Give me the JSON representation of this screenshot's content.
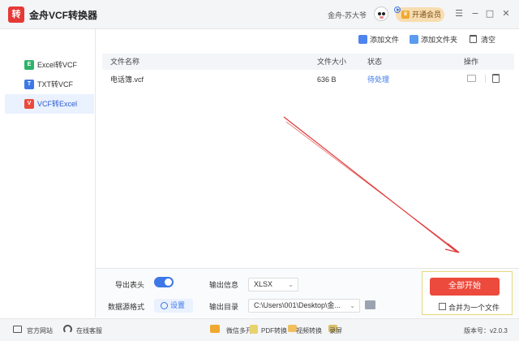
{
  "app": {
    "title": "金舟VCF转换器",
    "logo_glyph": "转",
    "user_name": "金舟-苏大爷",
    "vip_label": "开通会员",
    "vip_glyph": "♛",
    "window_controls": {
      "menu": "☰",
      "minimize": "−",
      "maximize": "□",
      "close": "✕"
    }
  },
  "sidebar": {
    "items": [
      {
        "label": "Excel转VCF",
        "badge": "E",
        "badge_color": "#2fb36b",
        "active": false
      },
      {
        "label": "TXT转VCF",
        "badge": "T",
        "badge_color": "#3d78e6",
        "active": false
      },
      {
        "label": "VCF转Excel",
        "badge": "V",
        "badge_color": "#ec4a3c",
        "active": true
      }
    ]
  },
  "toolbar": {
    "add_file": "添加文件",
    "add_folder": "添加文件夹",
    "clear": "清空"
  },
  "table": {
    "headers": {
      "name": "文件名称",
      "size": "文件大小",
      "status": "状态",
      "action": "操作"
    },
    "rows": [
      {
        "name": "电话簿.vcf",
        "size": "636 B",
        "status": "待处理"
      }
    ]
  },
  "options": {
    "export_header_label": "导出表头",
    "export_header_on": true,
    "source_format_label": "数据源格式",
    "settings_label": "设置",
    "output_info_label": "输出信息",
    "output_format": "XLSX",
    "output_dir_label": "输出目录",
    "output_dir": "C:\\Users\\001\\Desktop\\金..."
  },
  "start": {
    "button_label": "全部开始",
    "merge_label": "合并为一个文件",
    "merge_checked": false
  },
  "statusbar": {
    "website": "官方网站",
    "support": "在线客服",
    "multi_open": "微信多开",
    "pdf_convert": "PDF转换",
    "video_convert": "视频转换",
    "record": "录屏",
    "version": "版本号：v2.0.3"
  },
  "colors": {
    "accent": "#3d78e6",
    "start_button": "#ec4a3c",
    "arrow": "#e03a3a"
  }
}
